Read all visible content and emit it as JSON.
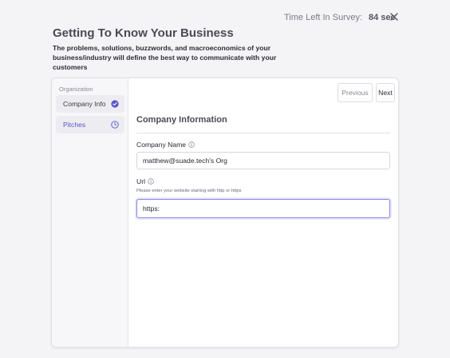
{
  "header": {
    "timer_label": "Time Left In Survey:",
    "timer_value": "84 sec",
    "title": "Getting To Know Your Business",
    "description": "The problems, solutions, buzzwords, and macroeconomics of your business/industry will define the best way to communicate with your customers"
  },
  "sidebar": {
    "section_label": "Organization",
    "items": [
      {
        "label": "Company Info",
        "status_icon": "check-circle-icon"
      },
      {
        "label": "Pitches",
        "status_icon": "clock-icon"
      }
    ]
  },
  "toolbar": {
    "previous_label": "Previous",
    "next_label": "Next"
  },
  "form": {
    "section_title": "Company Information",
    "company_name_label": "Company Name",
    "company_name_value": "matthew@suade.tech's Org",
    "url_label": "Url",
    "url_helper": "Please enter your website starting with http or https",
    "url_value": "https:"
  },
  "colors": {
    "accent": "#5b55c8",
    "focus_border": "#8a86e0"
  }
}
